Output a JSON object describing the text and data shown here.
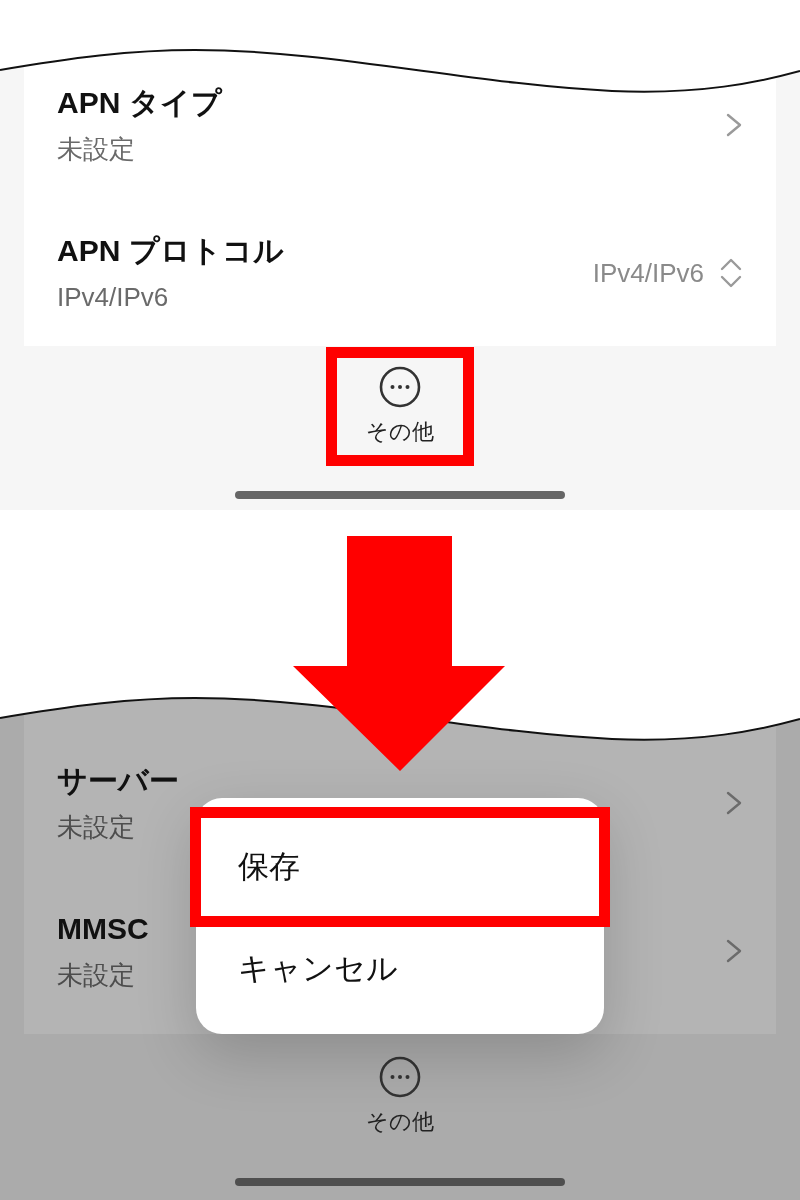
{
  "panels": [
    {
      "dimmed": false,
      "rows": [
        {
          "kind": "link",
          "title": "APN タイプ",
          "subtitle": "未設定"
        },
        {
          "kind": "select",
          "title": "APN プロトコル",
          "subtitle": "IPv4/IPv6",
          "value": "IPv4/IPv6"
        }
      ],
      "more_button": {
        "label": "その他",
        "highlighted": true
      }
    },
    {
      "dimmed": true,
      "rows": [
        {
          "kind": "link",
          "title": "サーバー",
          "subtitle": "未設定"
        },
        {
          "kind": "link",
          "title": "MMSC",
          "subtitle": "未設定"
        }
      ],
      "more_button": {
        "label": "その他",
        "highlighted": false
      },
      "popup_menu": {
        "items": [
          {
            "label": "保存",
            "highlighted": true
          },
          {
            "label": "キャンセル",
            "highlighted": false
          }
        ]
      }
    }
  ]
}
